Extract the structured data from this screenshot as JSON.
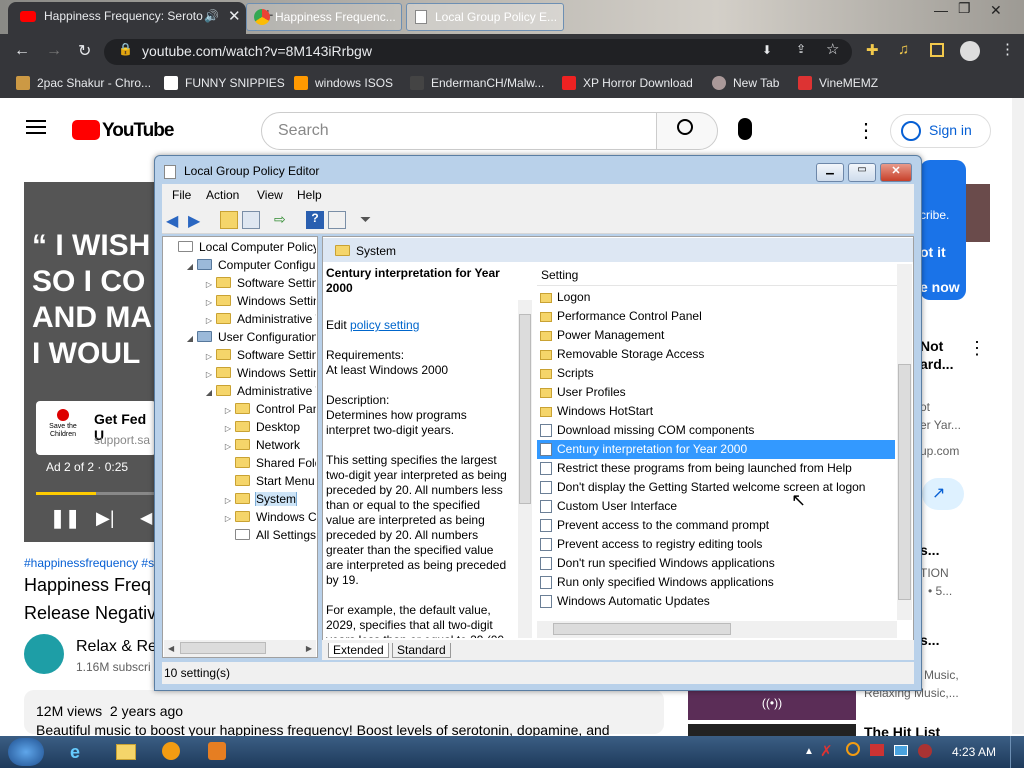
{
  "browser": {
    "tab_title": "Happiness Frequency: Seroto",
    "url": "youtube.com/watch?v=8M143iRrbgw",
    "bookmarks": [
      "2pac Shakur - Chro...",
      "FUNNY SNIPPIES",
      "windows ISOS",
      "EndermanCH/Malw...",
      "XP Horror Download",
      "New Tab",
      "VineMEMZ"
    ]
  },
  "youtube": {
    "logo": "YouTube",
    "search_placeholder": "Search",
    "signin": "Sign in",
    "video_text": "“ I WISH\nSO I CO\nAND MA\nI WOUL",
    "ad_title": "Get Fed U",
    "ad_url": "support.sa",
    "ad_logo": "Save the Children",
    "ad_status": "Ad 2 of 2 · 0:25",
    "hashtags": "#happinessfrequency #s",
    "title_line1": "Happiness Freq",
    "title_line2": "Release Negativ",
    "channel": "Relax & Re",
    "subs": "1.16M subscri",
    "views": "12M views  2 years ago",
    "description": "Beautiful music to boost your happiness frequency! Boost levels of serotonin, dopamine, and",
    "side": [
      "cribe.",
      "ot it",
      "e now",
      "Not",
      "ard...",
      "ot",
      "er Yar...",
      "up.com",
      "s...",
      "TION",
      "• 5...",
      "s...",
      "Music,",
      "Relaxing Music,...",
      "The Hit List"
    ]
  },
  "gpe": {
    "title": "Local Group Policy Editor",
    "menu": [
      "File",
      "Action",
      "View",
      "Help"
    ],
    "tree": [
      {
        "label": "Local Computer Policy",
        "exp": "",
        "indent": 0
      },
      {
        "label": "Computer Configura",
        "exp": "◢",
        "indent": 1
      },
      {
        "label": "Software Settings",
        "exp": "▷",
        "indent": 2
      },
      {
        "label": "Windows Setting",
        "exp": "▷",
        "indent": 2
      },
      {
        "label": "Administrative Te",
        "exp": "▷",
        "indent": 2
      },
      {
        "label": "User Configuration",
        "exp": "◢",
        "indent": 1
      },
      {
        "label": "Software Settings",
        "exp": "▷",
        "indent": 2
      },
      {
        "label": "Windows Setting",
        "exp": "▷",
        "indent": 2
      },
      {
        "label": "Administrative Te",
        "exp": "◢",
        "indent": 2
      },
      {
        "label": "Control Panel",
        "exp": "▷",
        "indent": 3
      },
      {
        "label": "Desktop",
        "exp": "▷",
        "indent": 3
      },
      {
        "label": "Network",
        "exp": "▷",
        "indent": 3
      },
      {
        "label": "Shared Folder",
        "exp": "",
        "indent": 3
      },
      {
        "label": "Start Menu ar",
        "exp": "",
        "indent": 3
      },
      {
        "label": "System",
        "exp": "▷",
        "indent": 3,
        "selected": true
      },
      {
        "label": "Windows Cor",
        "exp": "▷",
        "indent": 3
      },
      {
        "label": "All Settings",
        "exp": "",
        "indent": 3
      }
    ],
    "right_header": "System",
    "desc_title": "Century interpretation for Year 2000",
    "desc_edit": "Edit",
    "desc_link": "policy setting",
    "desc_req_label": "Requirements:",
    "desc_req": "At least Windows 2000",
    "desc_label": "Description:",
    "desc_text": "Determines how programs interpret two-digit years.",
    "desc_p2": "This setting specifies the largest two-digit year interpreted as being preceded by 20. All numbers less than or equal to the specified value are interpreted as being preceded by 20. All numbers greater than the specified value are interpreted as being preceded by 19.",
    "desc_p3": "For example, the default value, 2029, specifies that all two-digit years less than or equal to 29 (00",
    "list_header": "Setting",
    "rows": [
      {
        "label": "Logon",
        "type": "folder"
      },
      {
        "label": "Performance Control Panel",
        "type": "folder"
      },
      {
        "label": "Power Management",
        "type": "folder"
      },
      {
        "label": "Removable Storage Access",
        "type": "folder"
      },
      {
        "label": "Scripts",
        "type": "folder"
      },
      {
        "label": "User Profiles",
        "type": "folder"
      },
      {
        "label": "Windows HotStart",
        "type": "folder"
      },
      {
        "label": "Download missing COM components",
        "type": "setting"
      },
      {
        "label": "Century interpretation for Year 2000",
        "type": "setting",
        "selected": true
      },
      {
        "label": "Restrict these programs from being launched from Help",
        "type": "setting"
      },
      {
        "label": "Don't display the Getting Started welcome screen at logon",
        "type": "setting"
      },
      {
        "label": "Custom User Interface",
        "type": "setting"
      },
      {
        "label": "Prevent access to the command prompt",
        "type": "setting"
      },
      {
        "label": "Prevent access to registry editing tools",
        "type": "setting"
      },
      {
        "label": "Don't run specified Windows applications",
        "type": "setting"
      },
      {
        "label": "Run only specified Windows applications",
        "type": "setting"
      },
      {
        "label": "Windows Automatic Updates",
        "type": "setting"
      }
    ],
    "tabs": [
      "Extended",
      "Standard"
    ],
    "status": "10 setting(s)"
  },
  "taskbar": {
    "chrome_btn": "Happiness Frequenc...",
    "gpe_btn": "Local Group Policy E...",
    "clock": "4:23 AM"
  }
}
